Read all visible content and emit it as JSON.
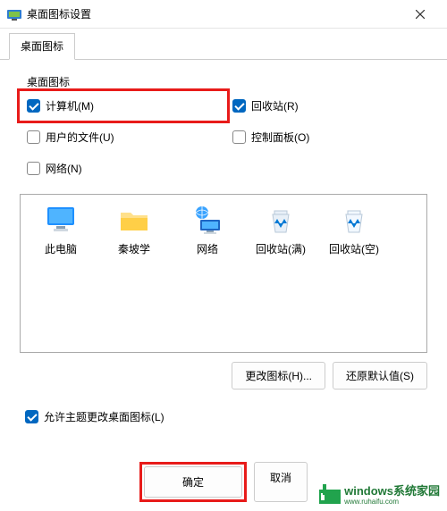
{
  "titlebar": {
    "title": "桌面图标设置"
  },
  "tabs": {
    "main": "桌面图标"
  },
  "section": {
    "label": "桌面图标"
  },
  "checks": {
    "computer": {
      "label": "计算机(M)",
      "checked": true
    },
    "recycle": {
      "label": "回收站(R)",
      "checked": true
    },
    "userfiles": {
      "label": "用户的文件(U)",
      "checked": false
    },
    "control": {
      "label": "控制面板(O)",
      "checked": false
    },
    "network": {
      "label": "网络(N)",
      "checked": false
    }
  },
  "icons": {
    "thispc": "此电脑",
    "qinpo": "秦坡学",
    "network": "网络",
    "recyclefull": "回收站(满)",
    "recycleempty": "回收站(空)"
  },
  "buttons": {
    "change": "更改图标(H)...",
    "restore": "还原默认值(S)"
  },
  "allow": {
    "label": "允许主题更改桌面图标(L)",
    "checked": true
  },
  "footer": {
    "ok": "确定",
    "cancel": "取消"
  },
  "watermark": {
    "brand": "windows系统家园",
    "url": "www.ruhaifu.com"
  }
}
